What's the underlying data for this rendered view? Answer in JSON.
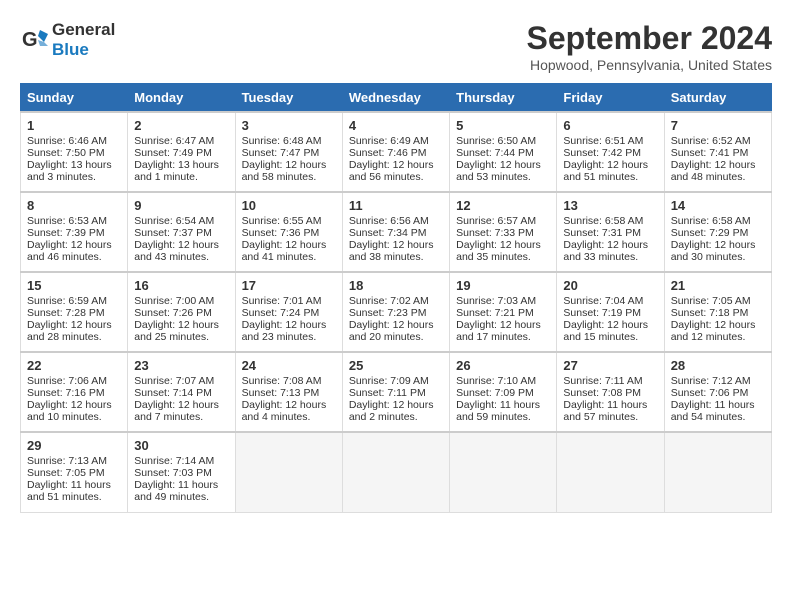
{
  "header": {
    "logo_line1": "General",
    "logo_line2": "Blue",
    "month": "September 2024",
    "location": "Hopwood, Pennsylvania, United States"
  },
  "days_of_week": [
    "Sunday",
    "Monday",
    "Tuesday",
    "Wednesday",
    "Thursday",
    "Friday",
    "Saturday"
  ],
  "weeks": [
    [
      {
        "day": "1",
        "sunrise": "6:46 AM",
        "sunset": "7:50 PM",
        "daylight": "13 hours and 3 minutes."
      },
      {
        "day": "2",
        "sunrise": "6:47 AM",
        "sunset": "7:49 PM",
        "daylight": "13 hours and 1 minute."
      },
      {
        "day": "3",
        "sunrise": "6:48 AM",
        "sunset": "7:47 PM",
        "daylight": "12 hours and 58 minutes."
      },
      {
        "day": "4",
        "sunrise": "6:49 AM",
        "sunset": "7:46 PM",
        "daylight": "12 hours and 56 minutes."
      },
      {
        "day": "5",
        "sunrise": "6:50 AM",
        "sunset": "7:44 PM",
        "daylight": "12 hours and 53 minutes."
      },
      {
        "day": "6",
        "sunrise": "6:51 AM",
        "sunset": "7:42 PM",
        "daylight": "12 hours and 51 minutes."
      },
      {
        "day": "7",
        "sunrise": "6:52 AM",
        "sunset": "7:41 PM",
        "daylight": "12 hours and 48 minutes."
      }
    ],
    [
      {
        "day": "8",
        "sunrise": "6:53 AM",
        "sunset": "7:39 PM",
        "daylight": "12 hours and 46 minutes."
      },
      {
        "day": "9",
        "sunrise": "6:54 AM",
        "sunset": "7:37 PM",
        "daylight": "12 hours and 43 minutes."
      },
      {
        "day": "10",
        "sunrise": "6:55 AM",
        "sunset": "7:36 PM",
        "daylight": "12 hours and 41 minutes."
      },
      {
        "day": "11",
        "sunrise": "6:56 AM",
        "sunset": "7:34 PM",
        "daylight": "12 hours and 38 minutes."
      },
      {
        "day": "12",
        "sunrise": "6:57 AM",
        "sunset": "7:33 PM",
        "daylight": "12 hours and 35 minutes."
      },
      {
        "day": "13",
        "sunrise": "6:58 AM",
        "sunset": "7:31 PM",
        "daylight": "12 hours and 33 minutes."
      },
      {
        "day": "14",
        "sunrise": "6:58 AM",
        "sunset": "7:29 PM",
        "daylight": "12 hours and 30 minutes."
      }
    ],
    [
      {
        "day": "15",
        "sunrise": "6:59 AM",
        "sunset": "7:28 PM",
        "daylight": "12 hours and 28 minutes."
      },
      {
        "day": "16",
        "sunrise": "7:00 AM",
        "sunset": "7:26 PM",
        "daylight": "12 hours and 25 minutes."
      },
      {
        "day": "17",
        "sunrise": "7:01 AM",
        "sunset": "7:24 PM",
        "daylight": "12 hours and 23 minutes."
      },
      {
        "day": "18",
        "sunrise": "7:02 AM",
        "sunset": "7:23 PM",
        "daylight": "12 hours and 20 minutes."
      },
      {
        "day": "19",
        "sunrise": "7:03 AM",
        "sunset": "7:21 PM",
        "daylight": "12 hours and 17 minutes."
      },
      {
        "day": "20",
        "sunrise": "7:04 AM",
        "sunset": "7:19 PM",
        "daylight": "12 hours and 15 minutes."
      },
      {
        "day": "21",
        "sunrise": "7:05 AM",
        "sunset": "7:18 PM",
        "daylight": "12 hours and 12 minutes."
      }
    ],
    [
      {
        "day": "22",
        "sunrise": "7:06 AM",
        "sunset": "7:16 PM",
        "daylight": "12 hours and 10 minutes."
      },
      {
        "day": "23",
        "sunrise": "7:07 AM",
        "sunset": "7:14 PM",
        "daylight": "12 hours and 7 minutes."
      },
      {
        "day": "24",
        "sunrise": "7:08 AM",
        "sunset": "7:13 PM",
        "daylight": "12 hours and 4 minutes."
      },
      {
        "day": "25",
        "sunrise": "7:09 AM",
        "sunset": "7:11 PM",
        "daylight": "12 hours and 2 minutes."
      },
      {
        "day": "26",
        "sunrise": "7:10 AM",
        "sunset": "7:09 PM",
        "daylight": "11 hours and 59 minutes."
      },
      {
        "day": "27",
        "sunrise": "7:11 AM",
        "sunset": "7:08 PM",
        "daylight": "11 hours and 57 minutes."
      },
      {
        "day": "28",
        "sunrise": "7:12 AM",
        "sunset": "7:06 PM",
        "daylight": "11 hours and 54 minutes."
      }
    ],
    [
      {
        "day": "29",
        "sunrise": "7:13 AM",
        "sunset": "7:05 PM",
        "daylight": "11 hours and 51 minutes."
      },
      {
        "day": "30",
        "sunrise": "7:14 AM",
        "sunset": "7:03 PM",
        "daylight": "11 hours and 49 minutes."
      },
      null,
      null,
      null,
      null,
      null
    ]
  ]
}
